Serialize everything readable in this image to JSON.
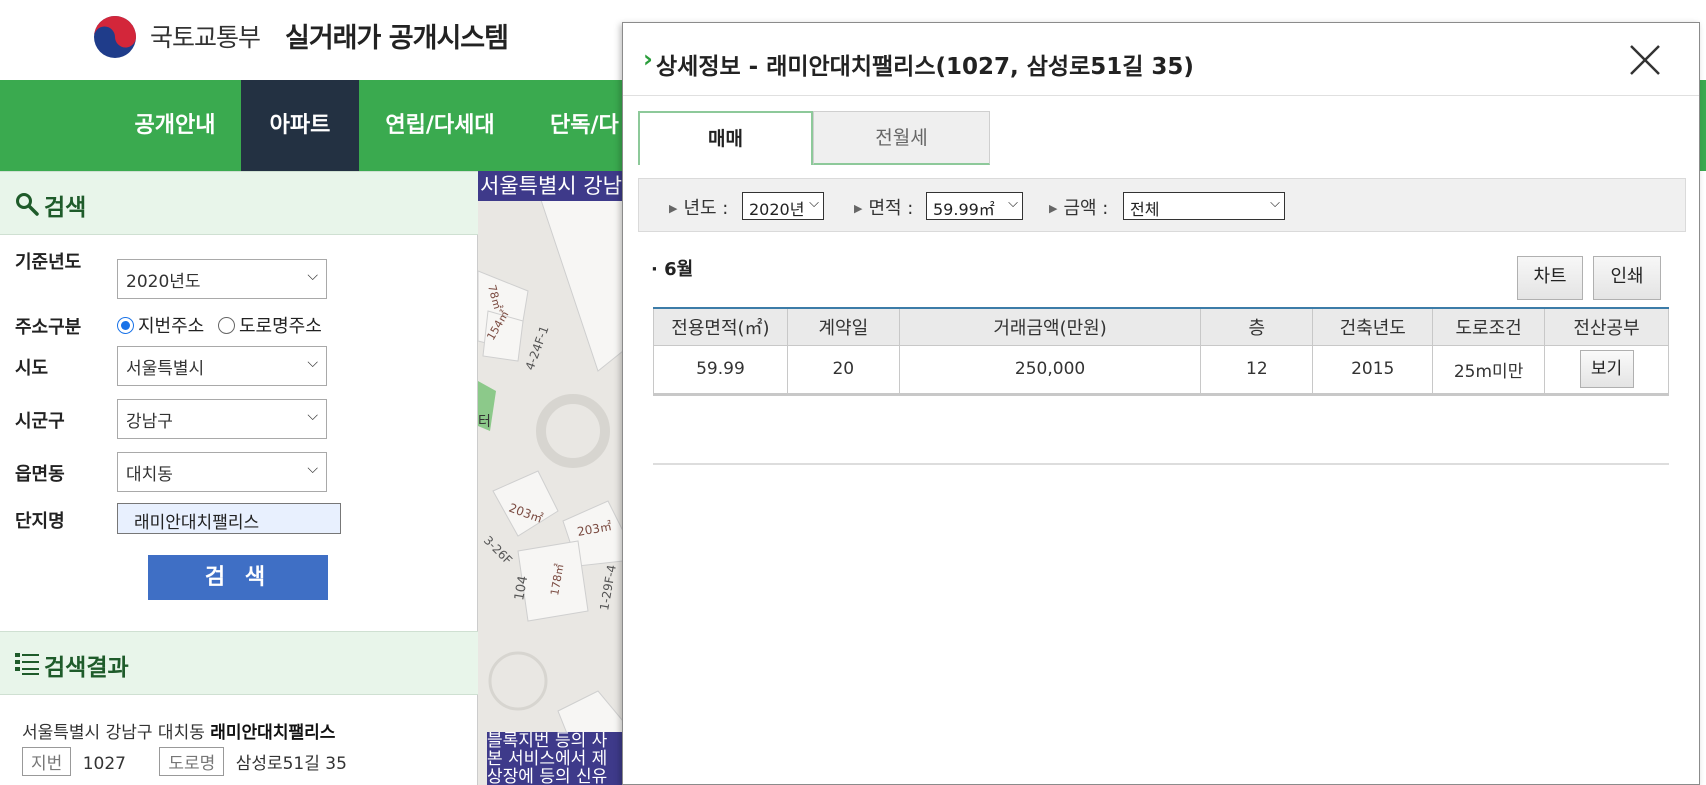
{
  "header": {
    "ministry": "국토교통부",
    "system_name": "실거래가 공개시스템"
  },
  "gnb": {
    "items": [
      "공개안내",
      "아파트",
      "연립/다세대",
      "단독/다가구"
    ],
    "active_index": 1
  },
  "search_panel": {
    "title": "검색",
    "labels": {
      "year": "기준년도",
      "addr_type": "주소구분",
      "sido": "시도",
      "sigungu": "시군구",
      "dong": "읍면동",
      "complex": "단지명"
    },
    "values": {
      "year": "2020년도",
      "sido": "서울특별시",
      "sigungu": "강남구",
      "dong": "대치동",
      "complex": "래미안대치팰리스"
    },
    "radio_jibun": "지번주소",
    "radio_road": "도로명주소",
    "radio_selected": "jibun",
    "search_button": "검 색"
  },
  "result_panel": {
    "title": "검색결과",
    "address": "서울특별시 강남구 대치동",
    "complex_name": "래미안대치팰리스",
    "jibun_tag": "지번",
    "jibun_value": "1027",
    "road_tag": "도로명",
    "road_value": "삼성로51길 35"
  },
  "map": {
    "banner": "서울특별시 강남구 대치동",
    "notice_line1": "블록지번 등의 사",
    "notice_line2": "본 서비스에서 제",
    "notice_line3": "상장에 등의 신유"
  },
  "modal": {
    "title": "상세정보 - 래미안대치팰리스(1027, 삼성로51길 35)",
    "tabs": [
      "매매",
      "전월세"
    ],
    "active_tab": 0,
    "filters": {
      "year_label": "년도 :",
      "year_value": "2020년",
      "area_label": "면적 :",
      "area_value": "59.99㎡",
      "price_label": "금액 :",
      "price_value": "전체"
    },
    "month": "6월",
    "chart_button": "차트",
    "print_button": "인쇄",
    "table": {
      "headers": [
        "전용면적(㎡)",
        "계약일",
        "거래금액(만원)",
        "층",
        "건축년도",
        "도로조건",
        "전산공부"
      ],
      "rows": [
        {
          "area": "59.99",
          "day": "20",
          "price": "250,000",
          "floor": "12",
          "built": "2015",
          "road": "25m미만",
          "view": "보기"
        }
      ]
    }
  },
  "colors": {
    "brand_green": "#3aaa4f",
    "nav_active": "#233142",
    "search_button": "#3f6fc5",
    "map_label": "#3e3a8a"
  }
}
